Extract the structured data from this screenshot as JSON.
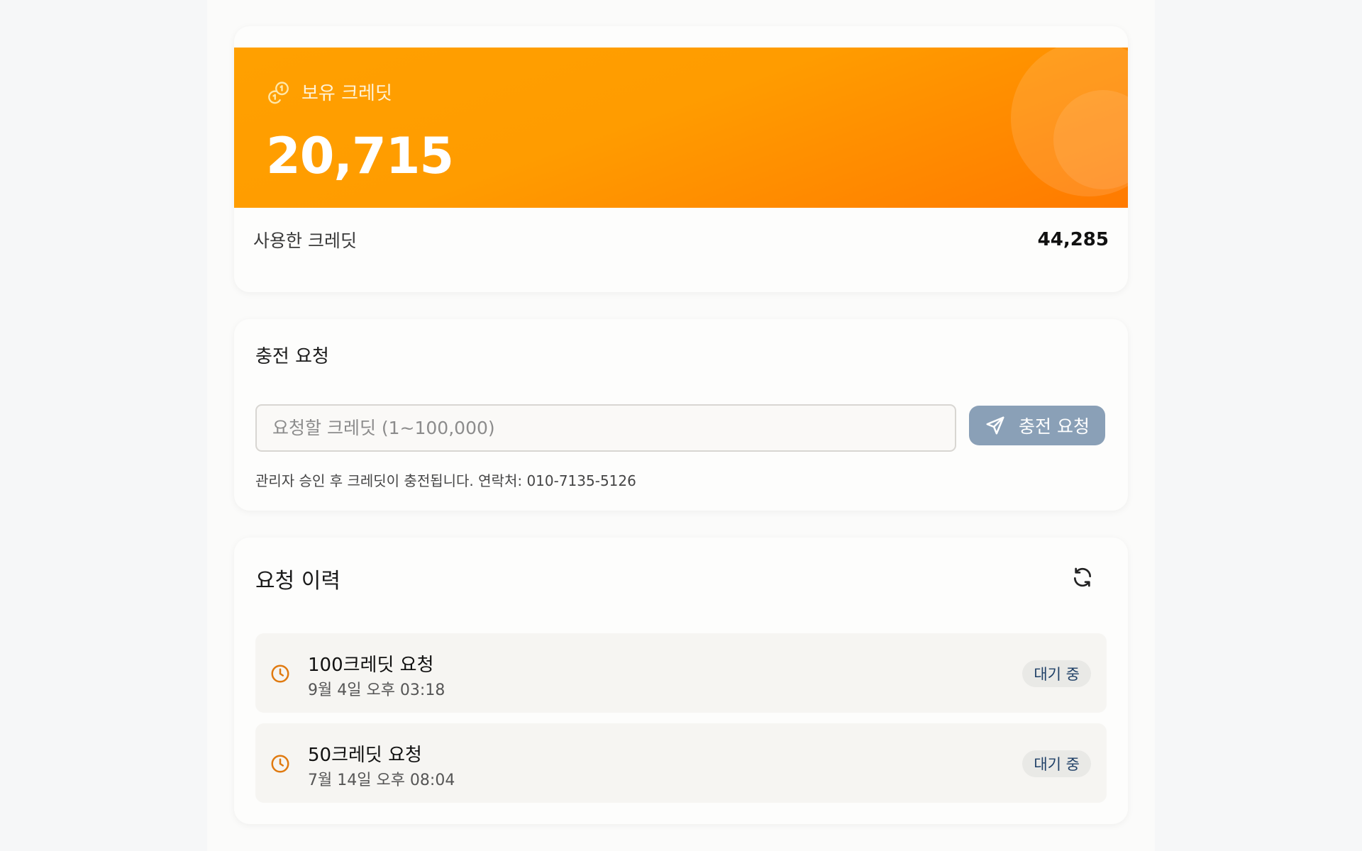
{
  "colors": {
    "accent_orange": "#ff9a00",
    "button_bg": "#8aa0b7",
    "clock_icon": "#e07a10",
    "badge_text": "#1e3f66"
  },
  "credit": {
    "icon": "coins-icon",
    "label": "보유 크레딧",
    "value": "20,715",
    "used_label": "사용한 크레딧",
    "used_value": "44,285"
  },
  "charge": {
    "title": "충전 요청",
    "input_value": "",
    "input_placeholder": "요청할 크레딧 (1~100,000)",
    "button_icon": "send-icon",
    "button_label": "충전 요청",
    "note": "관리자 승인 후 크레딧이 충전됩니다. 연락처: 010-7135-5126"
  },
  "history": {
    "title": "요청 이력",
    "refresh_icon": "refresh-icon",
    "items": [
      {
        "title": "100크레딧 요청",
        "date": "9월 4일 오후 03:18",
        "status": "대기 중",
        "icon": "clock-icon"
      },
      {
        "title": "50크레딧 요청",
        "date": "7월 14일 오후 08:04",
        "status": "대기 중",
        "icon": "clock-icon"
      }
    ]
  }
}
